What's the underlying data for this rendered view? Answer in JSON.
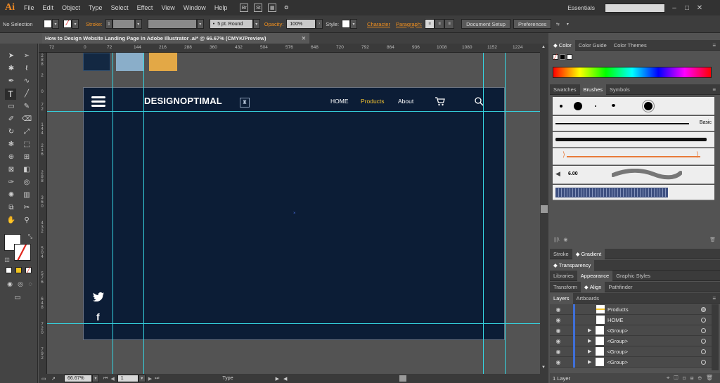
{
  "app": {
    "logo": "Ai",
    "menu": [
      "File",
      "Edit",
      "Object",
      "Type",
      "Select",
      "Effect",
      "View",
      "Window",
      "Help"
    ],
    "workspace": "Essentials",
    "search_placeholder": ""
  },
  "control": {
    "selection": "No Selection",
    "stroke_label": "Stroke:",
    "brush": "5 pt. Round",
    "opacity_label": "Opacity:",
    "opacity_value": "100%",
    "style_label": "Style:",
    "character": "Character",
    "paragraph": "Paragraph:",
    "doc_setup": "Document Setup",
    "preferences": "Preferences"
  },
  "document": {
    "tab_title": "How to Design Website Landing Page in Adobe Illustrator .ai* @ 66.67% (CMYK/Preview)"
  },
  "ruler": {
    "h": [
      "72",
      "0",
      "72",
      "144",
      "216",
      "288",
      "360",
      "432",
      "504",
      "576",
      "648",
      "720",
      "792",
      "864",
      "936",
      "1008",
      "1080",
      "1152",
      "1224"
    ],
    "v": [
      "2 8 8",
      "2",
      "0",
      "7 2",
      "1 4 4",
      "2 1 6",
      "2 8 8",
      "3 6 0",
      "4 3 2",
      "5 0 4",
      "5 7 6",
      "6 4 8",
      "7 2 0",
      "7 9 2"
    ]
  },
  "artboard": {
    "brand": "DESIGNOPTIMAL",
    "nav": [
      "HOME",
      "Products",
      "About"
    ],
    "active_nav": "Products",
    "swatches": [
      "#132842",
      "#8aaec9",
      "#e3a846"
    ],
    "bg": "#0c1d36",
    "accent": "#f4c430"
  },
  "status": {
    "zoom": "66.67%",
    "page": "1",
    "tool": "Type"
  },
  "panels": {
    "color_tabs": [
      "Color",
      "Color Guide",
      "Color Themes"
    ],
    "brush_tabs": [
      "Swatches",
      "Brushes",
      "Symbols"
    ],
    "brush_basic": "Basic",
    "brush_size": "6.00",
    "stroke_tabs": [
      "Stroke",
      "Gradient"
    ],
    "transparency": "Transparency",
    "app_tabs": [
      "Libraries",
      "Appearance",
      "Graphic Styles"
    ],
    "align_tabs": [
      "Transform",
      "Align",
      "Pathfinder"
    ],
    "layer_tabs": [
      "Layers",
      "Artboards"
    ],
    "layers": [
      "Products",
      "HOME",
      "<Group>",
      "<Group>",
      "<Group>",
      "<Group>"
    ],
    "layer_count": "1 Layer"
  }
}
